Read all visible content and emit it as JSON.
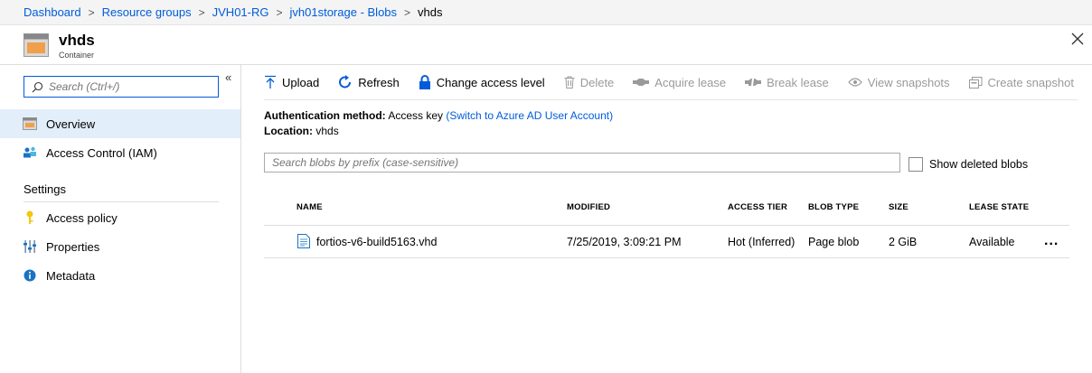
{
  "breadcrumb": {
    "items": [
      "Dashboard",
      "Resource groups",
      "JVH01-RG",
      "jvh01storage - Blobs"
    ],
    "current": "vhds",
    "separator": ">"
  },
  "header": {
    "title": "vhds",
    "subtitle": "Container",
    "close_icon": "close-icon"
  },
  "sidebar": {
    "search_placeholder": "Search (Ctrl+/)",
    "collapse_label": "«",
    "items": [
      {
        "label": "Overview",
        "icon": "container-icon",
        "active": true
      },
      {
        "label": "Access Control (IAM)",
        "icon": "people-icon",
        "active": false
      }
    ],
    "section_title": "Settings",
    "settings_items": [
      {
        "label": "Access policy",
        "icon": "key-icon"
      },
      {
        "label": "Properties",
        "icon": "sliders-icon"
      },
      {
        "label": "Metadata",
        "icon": "info-icon"
      }
    ]
  },
  "toolbar": {
    "upload": "Upload",
    "refresh": "Refresh",
    "change_access": "Change access level",
    "delete": "Delete",
    "acquire_lease": "Acquire lease",
    "break_lease": "Break lease",
    "view_snapshots": "View snapshots",
    "create_snapshot": "Create snapshot"
  },
  "info": {
    "auth_label": "Authentication method:",
    "auth_value": "Access key",
    "auth_link": "(Switch to Azure AD User Account)",
    "location_label": "Location:",
    "location_value": "vhds"
  },
  "blob_search": {
    "placeholder": "Search blobs by prefix (case-sensitive)"
  },
  "show_deleted": {
    "label": "Show deleted blobs",
    "checked": false
  },
  "table": {
    "columns": [
      "NAME",
      "MODIFIED",
      "ACCESS TIER",
      "BLOB TYPE",
      "SIZE",
      "LEASE STATE"
    ],
    "rows": [
      {
        "name": "fortios-v6-build5163.vhd",
        "modified": "7/25/2019, 3:09:21 PM",
        "access_tier": "Hot (Inferred)",
        "blob_type": "Page blob",
        "size": "2 GiB",
        "lease_state": "Available",
        "more": "..."
      }
    ]
  },
  "colors": {
    "accent": "#015cda",
    "active_nav": "#e3eefb",
    "disabled": "#9a9a9a"
  }
}
